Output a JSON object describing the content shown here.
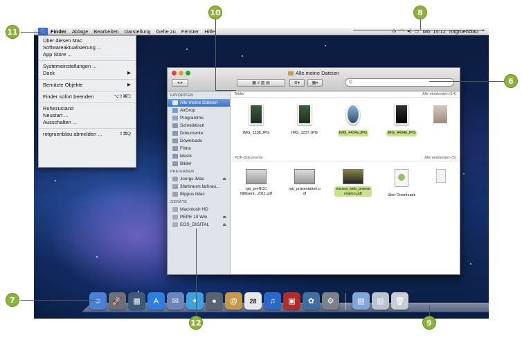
{
  "menubar": {
    "items": [
      "Finder",
      "Ablage",
      "Bearbeiten",
      "Darstellung",
      "Gehe zu",
      "Fenster",
      "Hilfe"
    ],
    "clock": "Mo. 15:12",
    "user": "rotgruenblau"
  },
  "apple_menu": {
    "items": [
      {
        "label": "Über diesen Mac"
      },
      {
        "label": "Softwareaktualisierung ..."
      },
      {
        "label": "App Store ..."
      },
      {
        "sep": true
      },
      {
        "label": "Systemeinstellungen ..."
      },
      {
        "label": "Dock",
        "arrow": "▶"
      },
      {
        "sep": true
      },
      {
        "label": "Benutzte Objekte",
        "arrow": "▶"
      },
      {
        "sep": true
      },
      {
        "label": "Finder sofort beenden",
        "shortcut": "⌥⇧⌘⎋"
      },
      {
        "sep": true
      },
      {
        "label": "Ruhezustand"
      },
      {
        "label": "Neustart ..."
      },
      {
        "label": "Ausschalten ..."
      },
      {
        "sep": true
      },
      {
        "label": "rotgruenblau abmelden ...",
        "shortcut": "⇧⌘Q"
      }
    ]
  },
  "finder": {
    "title": "Alle meine Dateien",
    "search_placeholder": "Q",
    "sidebar": {
      "favorites_header": "FAVORITEN",
      "favorites": [
        "Alle meine Dateien",
        "AirDrop",
        "Programme",
        "Schreibtisch",
        "Dokumente",
        "Downloads",
        "Filme",
        "Musik",
        "Bilder"
      ],
      "shared_header": "FREIGABEN",
      "shared": [
        {
          "label": "Joergs iMac",
          "eject": "⏏"
        },
        {
          "label": "3farbraum.farbrau..."
        },
        {
          "label": "filippos iMac"
        }
      ],
      "devices_header": "GERÄTE",
      "devices": [
        {
          "label": "Macintosh HD"
        },
        {
          "label": "PEPE 10 Win",
          "eject": "⏏"
        },
        {
          "label": "EOS_DIGITAL",
          "eject": "⏏"
        }
      ]
    },
    "sections": {
      "images": {
        "title": "Bilder",
        "more": "Alle einblenden (14)"
      },
      "pdfs": {
        "title": "PDF-Dokumente",
        "more": "Alle einblenden (5)"
      }
    },
    "images": [
      {
        "name": "IMG_1238.JPG",
        "highlight": false,
        "style": "green"
      },
      {
        "name": "IMG_1237.JPG",
        "highlight": false,
        "style": "green"
      },
      {
        "name": "IMG_4434v.JPG",
        "highlight": true,
        "style": "light"
      },
      {
        "name": "IMG_4434b.JPG",
        "highlight": true,
        "style": "dark"
      }
    ],
    "pdfs": [
      {
        "name1": "rgb_preNCC",
        "name2": "N88sent...2011.pdf",
        "highlight": false,
        "style": "gray"
      },
      {
        "name1": "rgb_präsentation.p",
        "name2": "df",
        "highlight": false,
        "style": "gray"
      },
      {
        "name1": "eucrea_web_praese",
        "name2": "ntation.pdf",
        "highlight": true,
        "style": "dark"
      },
      {
        "name1": "Über Downloads",
        "name2": "",
        "highlight": false,
        "style": "doc"
      }
    ]
  },
  "dock": {
    "icons": [
      {
        "name": "finder-icon",
        "color": "#4a7fd4",
        "glyph": "☺"
      },
      {
        "name": "launchpad-icon",
        "color": "#6b6f78",
        "glyph": "🚀"
      },
      {
        "name": "mission-control-icon",
        "color": "#3c5a7a",
        "glyph": "▦"
      },
      {
        "name": "app-store-icon",
        "color": "#2f7ee0",
        "glyph": "A"
      },
      {
        "name": "mail-icon",
        "color": "#6d86b8",
        "glyph": "✉"
      },
      {
        "name": "safari-icon",
        "color": "#3fa0e0",
        "glyph": "✦"
      },
      {
        "name": "facetime-icon",
        "color": "#5a6470",
        "glyph": "●"
      },
      {
        "name": "address-book-icon",
        "color": "#c49a4a",
        "glyph": "@"
      },
      {
        "name": "ical-icon",
        "color": "#e8e8e8",
        "glyph": "28"
      },
      {
        "name": "itunes-icon",
        "color": "#2c68c8",
        "glyph": "♫"
      },
      {
        "name": "photo-booth-icon",
        "color": "#b12d2d",
        "glyph": "▣"
      },
      {
        "name": "iphoto-icon",
        "color": "#3f6ea0",
        "glyph": "✿"
      },
      {
        "name": "system-preferences-icon",
        "color": "#7c8088",
        "glyph": "⚙"
      }
    ],
    "right_icons": [
      {
        "name": "applications-folder-icon",
        "color": "#7fa8d8",
        "glyph": "▤"
      },
      {
        "name": "documents-stack-icon",
        "color": "#b8c4d0",
        "glyph": "▥"
      },
      {
        "name": "trash-icon",
        "color": "#c8cdd4",
        "glyph": "🗑"
      }
    ]
  },
  "callouts": [
    "6",
    "7",
    "8",
    "9",
    "10",
    "11",
    "12"
  ]
}
